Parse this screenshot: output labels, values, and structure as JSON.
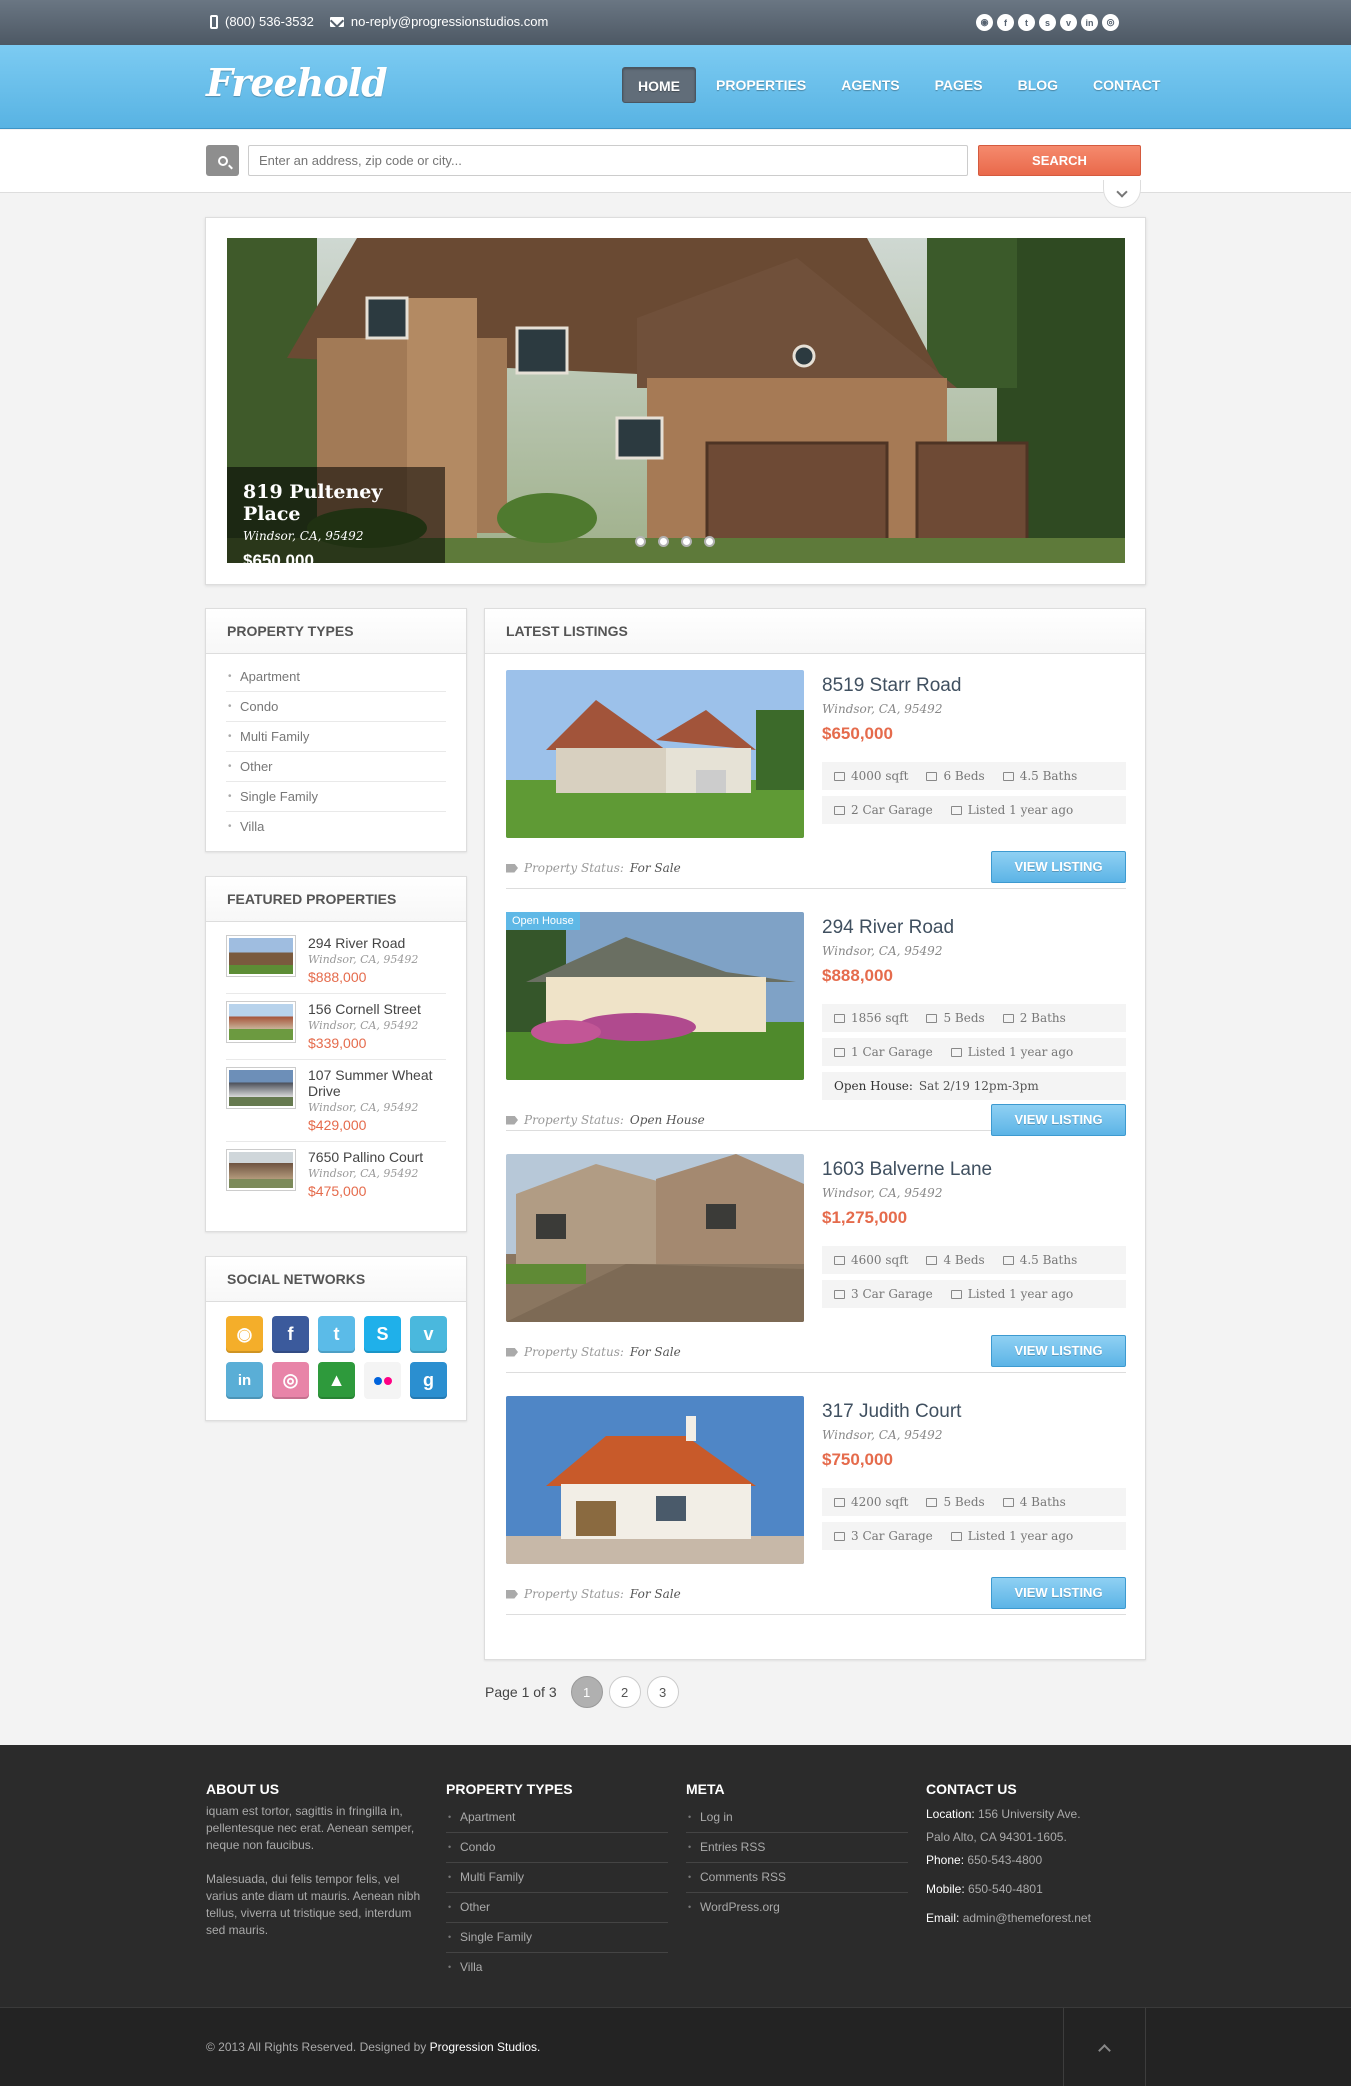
{
  "topbar": {
    "phone": "(800) 536-3532",
    "email": "no-reply@progressionstudios.com",
    "social": [
      "rss",
      "f",
      "t",
      "s",
      "v",
      "in",
      "d"
    ]
  },
  "header": {
    "logo": "Freehold",
    "nav": [
      "HOME",
      "PROPERTIES",
      "AGENTS",
      "PAGES",
      "BLOG",
      "CONTACT"
    ],
    "active": "HOME"
  },
  "search": {
    "placeholder": "Enter an address, zip code or city...",
    "button": "SEARCH"
  },
  "slider": {
    "title": "819 Pulteney Place",
    "location": "Windsor, CA, 95492",
    "price": "$650,000"
  },
  "sidebar": {
    "property_types_title": "PROPERTY TYPES",
    "property_types": [
      "Apartment",
      "Condo",
      "Multi Family",
      "Other",
      "Single Family",
      "Villa"
    ],
    "featured_title": "FEATURED PROPERTIES",
    "featured": [
      {
        "name": "294 River Road",
        "location": "Windsor, CA, 95492",
        "price": "$888,000"
      },
      {
        "name": "156 Cornell Street",
        "location": "Windsor, CA, 95492",
        "price": "$339,000"
      },
      {
        "name": "107 Summer Wheat Drive",
        "location": "Windsor, CA, 95492",
        "price": "$429,000"
      },
      {
        "name": "7650 Pallino Court",
        "location": "Windsor, CA, 95492",
        "price": "$475,000"
      }
    ],
    "social_title": "SOCIAL NETWORKS"
  },
  "listings": {
    "title": "LATEST LISTINGS",
    "status_label": "Property Status:",
    "button": "VIEW LISTING",
    "items": [
      {
        "title": "8519 Starr Road",
        "location": "Windsor, CA, 95492",
        "price": "$650,000",
        "sqft": "4000 sqft",
        "beds": "6 Beds",
        "baths": "4.5 Baths",
        "garage": "2 Car Garage",
        "listed": "Listed 1 year ago",
        "status": "For Sale"
      },
      {
        "title": "294 River Road",
        "location": "Windsor, CA, 95492",
        "price": "$888,000",
        "sqft": "1856 sqft",
        "beds": "5 Beds",
        "baths": "2 Baths",
        "garage": "1 Car Garage",
        "listed": "Listed 1 year ago",
        "status": "Open House",
        "badge": "Open House",
        "open_label": "Open House:",
        "open_time": "Sat 2/19 12pm-3pm"
      },
      {
        "title": "1603 Balverne Lane",
        "location": "Windsor, CA, 95492",
        "price": "$1,275,000",
        "sqft": "4600 sqft",
        "beds": "4 Beds",
        "baths": "4.5 Baths",
        "garage": "3 Car Garage",
        "listed": "Listed 1 year ago",
        "status": "For Sale"
      },
      {
        "title": "317 Judith Court",
        "location": "Windsor, CA, 95492",
        "price": "$750,000",
        "sqft": "4200 sqft",
        "beds": "5 Beds",
        "baths": "4 Baths",
        "garage": "3 Car Garage",
        "listed": "Listed 1 year ago",
        "status": "For Sale"
      }
    ]
  },
  "pagination": {
    "label": "Page 1 of 3",
    "pages": [
      "1",
      "2",
      "3"
    ]
  },
  "footer": {
    "about_title": "ABOUT US",
    "about_p1": "iquam est tortor, sagittis in fringilla in, pellentesque nec erat. Aenean semper, neque non faucibus.",
    "about_p2": "Malesuada, dui felis tempor felis, vel varius ante diam ut mauris. Aenean nibh tellus, viverra ut tristique sed, interdum sed mauris.",
    "types_title": "PROPERTY TYPES",
    "types": [
      "Apartment",
      "Condo",
      "Multi Family",
      "Other",
      "Single Family",
      "Villa"
    ],
    "meta_title": "META",
    "meta": [
      "Log in",
      "Entries RSS",
      "Comments RSS",
      "WordPress.org"
    ],
    "contact_title": "CONTACT US",
    "location_label": "Location:",
    "location": "156 University Ave.",
    "location2": "Palo Alto, CA 94301-1605.",
    "phone_label": "Phone:",
    "phone": "650-543-4800",
    "mobile_label": "Mobile:",
    "mobile": "650-540-4801",
    "email_label": "Email:",
    "email": "admin@themeforest.net"
  },
  "bottom": {
    "copyright": "© 2013 All Rights Reserved. Designed by",
    "designer": "Progression Studios."
  }
}
